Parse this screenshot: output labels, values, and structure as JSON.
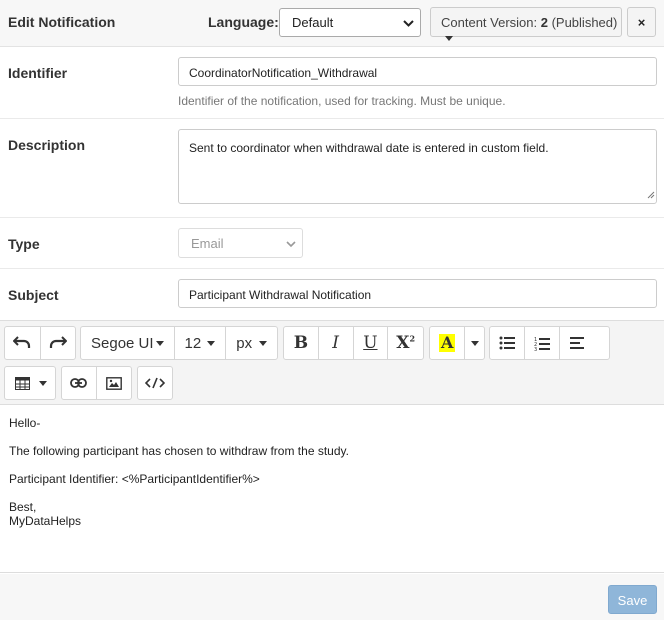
{
  "header": {
    "title": "Edit Notification",
    "language_label": "Language:",
    "language_value": "Default",
    "version_prefix": "Content Version: ",
    "version_number": "2",
    "version_status": " (Published)",
    "close_label": "×"
  },
  "form": {
    "identifier": {
      "label": "Identifier",
      "value": "CoordinatorNotification_Withdrawal",
      "help": "Identifier of the notification, used for tracking. Must be unique."
    },
    "description": {
      "label": "Description",
      "value": "Sent to coordinator when withdrawal date is entered in custom field."
    },
    "type": {
      "label": "Type",
      "value": "Email"
    },
    "subject": {
      "label": "Subject",
      "value": "Participant Withdrawal Notification"
    }
  },
  "toolbar": {
    "font_family": "Segoe UI",
    "font_size": "12",
    "font_unit": "px",
    "bold": "B",
    "italic": "I",
    "underline": "U",
    "superscript": "X",
    "highlight": "A",
    "highlight_color": "#ffff00"
  },
  "editor": {
    "lines": [
      "Hello-",
      "The following participant has chosen to withdraw from the study.",
      "Participant Identifier: <%ParticipantIdentifier%>",
      "Best,",
      "MyDataHelps"
    ]
  },
  "footer": {
    "save_label": "Save"
  }
}
